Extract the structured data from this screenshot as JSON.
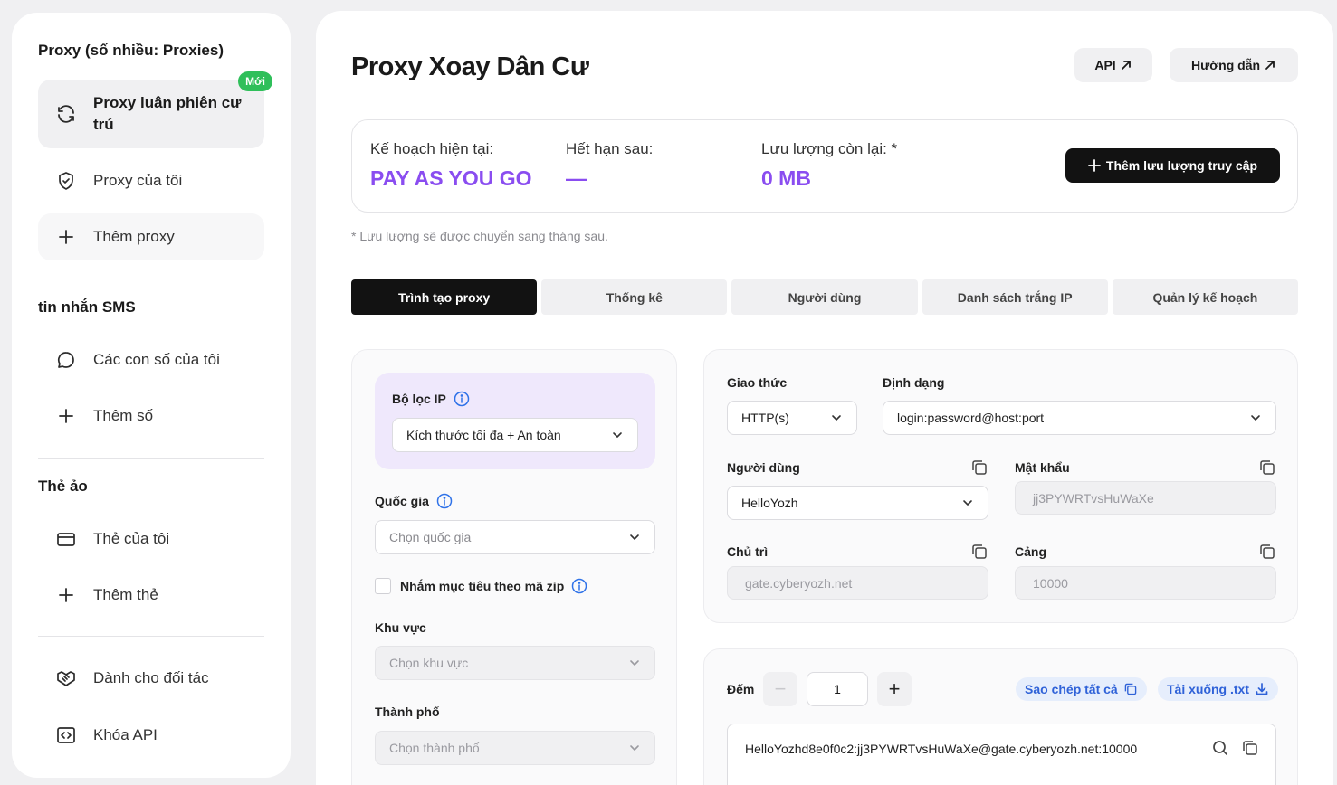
{
  "sidebar": {
    "proxy_section_title": "Proxy (số nhiều: Proxies)",
    "proxy_items": [
      {
        "label": "Proxy luân phiên cư trú",
        "icon": "refresh-icon",
        "badge": "Mới"
      },
      {
        "label": "Proxy của tôi",
        "icon": "shield-check-icon"
      },
      {
        "label": "Thêm proxy",
        "icon": "plus-icon"
      }
    ],
    "sms_section_title": "tin nhắn SMS",
    "sms_items": [
      {
        "label": "Các con số của tôi",
        "icon": "chat-bubble-icon"
      },
      {
        "label": "Thêm số",
        "icon": "plus-icon"
      }
    ],
    "card_section_title": "Thẻ ảo",
    "card_items": [
      {
        "label": "Thẻ của tôi",
        "icon": "credit-card-icon"
      },
      {
        "label": "Thêm thẻ",
        "icon": "plus-icon"
      }
    ],
    "extra_items": [
      {
        "label": "Dành cho đối tác",
        "icon": "handshake-icon"
      },
      {
        "label": "Khóa API",
        "icon": "code-brackets-icon"
      }
    ]
  },
  "header": {
    "title": "Proxy Xoay Dân Cư",
    "api_button": "API",
    "guide_button": "Hướng dẫn"
  },
  "plan": {
    "current_plan_label": "Kế hoạch hiện tại:",
    "current_plan_value": "PAY AS YOU GO",
    "expires_label": "Hết hạn sau:",
    "expires_value": "—",
    "traffic_label": "Lưu lượng còn lại: *",
    "traffic_value": "0 MB",
    "add_traffic_button": "Thêm lưu lượng truy cập",
    "note": "* Lưu lượng sẽ được chuyển sang tháng sau."
  },
  "tabs": [
    {
      "label": "Trình tạo proxy",
      "active": true
    },
    {
      "label": "Thống kê",
      "active": false
    },
    {
      "label": "Người dùng",
      "active": false
    },
    {
      "label": "Danh sách trắng IP",
      "active": false
    },
    {
      "label": "Quản lý kế hoạch",
      "active": false
    }
  ],
  "filters": {
    "ip_filter_label": "Bộ lọc IP",
    "ip_filter_value": "Kích thước tối đa + An toàn",
    "country_label": "Quốc gia",
    "country_placeholder": "Chọn quốc gia",
    "zip_label": "Nhắm mục tiêu theo mã zip",
    "region_label": "Khu vực",
    "region_placeholder": "Chọn khu vực",
    "city_label": "Thành phố",
    "city_placeholder": "Chọn thành phố"
  },
  "connection": {
    "protocol_label": "Giao thức",
    "protocol_value": "HTTP(s)",
    "format_label": "Định dạng",
    "format_value": "login:password@host:port",
    "user_label": "Người dùng",
    "user_value": "HelloYozh",
    "password_label": "Mật khẩu",
    "password_value": "jj3PYWRTvsHuWaXe",
    "host_label": "Chủ trì",
    "host_value": "gate.cyberyozh.net",
    "port_label": "Cảng",
    "port_value": "10000"
  },
  "output": {
    "count_label": "Đếm",
    "count_value": "1",
    "minus": "−",
    "plus": "+",
    "copy_all_button": "Sao chép tất cả",
    "download_button": "Tải xuống .txt",
    "proxy_line": "HelloYozhd8e0f0c2:jj3PYWRTvsHuWaXe@gate.cyberyozh.net:10000"
  },
  "colors": {
    "accent_purple": "#8a4df0",
    "badge_green": "#2fbf5a",
    "info_blue": "#2f72e8",
    "dark": "#121212"
  }
}
